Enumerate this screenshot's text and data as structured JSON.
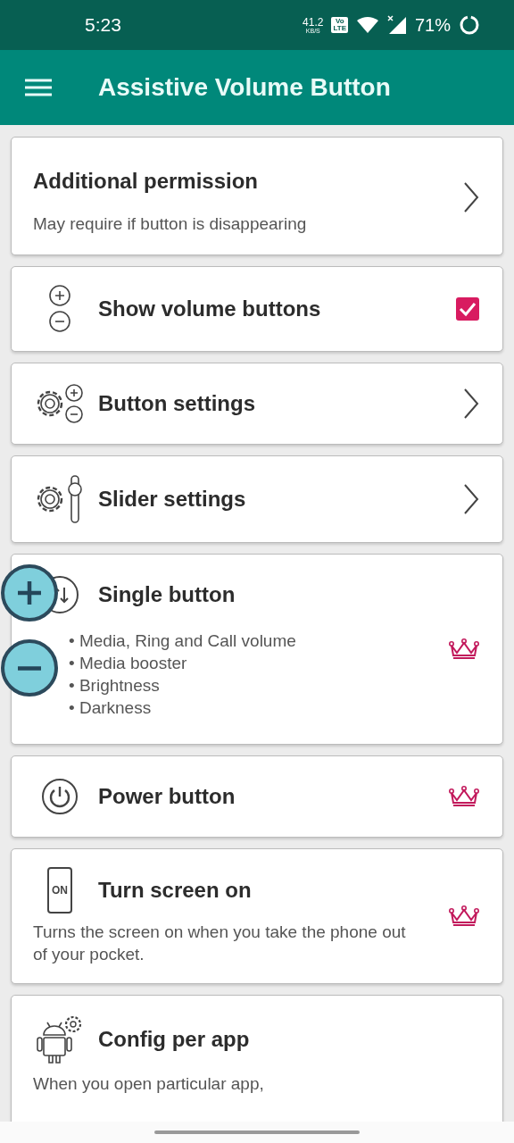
{
  "status_bar": {
    "time": "5:23",
    "speed": "41.2",
    "speed_unit": "KB/S",
    "volte": [
      "Vo",
      "LTE"
    ],
    "battery": "71%"
  },
  "app_bar": {
    "title": "Assistive Volume Button"
  },
  "items": [
    {
      "kind": "link",
      "title": "Additional permission",
      "subtitle": "May require if button is disappearing"
    },
    {
      "kind": "toggle",
      "title": "Show volume buttons",
      "checked": true
    },
    {
      "kind": "link",
      "title": "Button settings"
    },
    {
      "kind": "link",
      "title": "Slider settings"
    },
    {
      "kind": "premium",
      "title": "Single button",
      "bullets": [
        "• Media, Ring and Call volume",
        "• Media booster",
        "• Brightness",
        "• Darkness"
      ]
    },
    {
      "kind": "premium",
      "title": "Power button"
    },
    {
      "kind": "premium",
      "title": "Turn screen on",
      "icon_label": "ON",
      "subtitle": "Turns the screen on when you take the phone out of your pocket."
    },
    {
      "kind": "plain",
      "title": "Config per app",
      "subtitle": "When you open particular app,"
    }
  ]
}
